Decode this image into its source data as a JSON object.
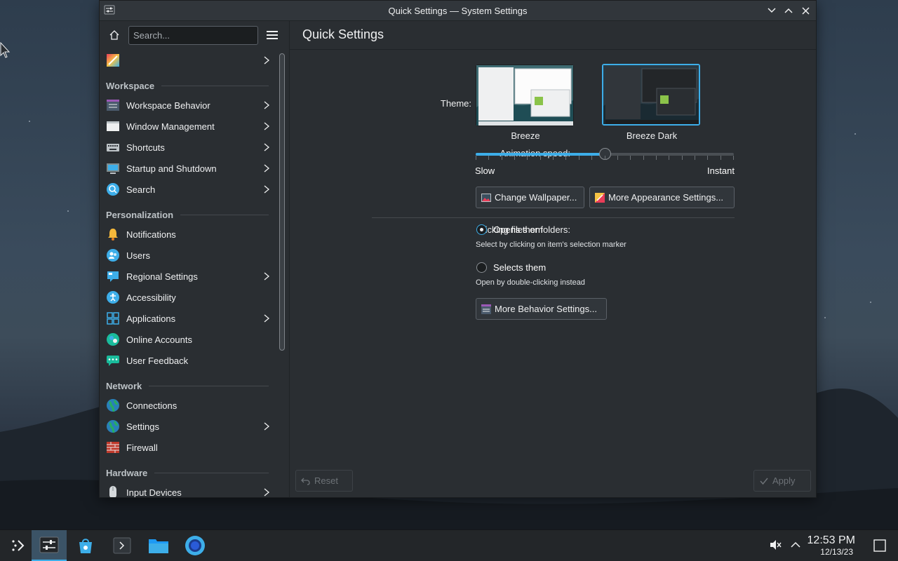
{
  "window": {
    "title": "Quick Settings — System Settings",
    "page_title": "Quick Settings"
  },
  "search": {
    "placeholder": "Search..."
  },
  "sidebar": {
    "top_item": {
      "icon": "quick-settings-icon"
    },
    "sections": [
      {
        "title": "Workspace",
        "items": [
          {
            "label": "Workspace Behavior",
            "icon": "workspace-behavior-icon",
            "has_children": true
          },
          {
            "label": "Window Management",
            "icon": "window-management-icon",
            "has_children": true
          },
          {
            "label": "Shortcuts",
            "icon": "keyboard-icon",
            "has_children": true
          },
          {
            "label": "Startup and Shutdown",
            "icon": "startup-icon",
            "has_children": true
          },
          {
            "label": "Search",
            "icon": "search-icon",
            "has_children": true
          }
        ]
      },
      {
        "title": "Personalization",
        "items": [
          {
            "label": "Notifications",
            "icon": "bell-icon",
            "has_children": false
          },
          {
            "label": "Users",
            "icon": "users-icon",
            "has_children": false
          },
          {
            "label": "Regional Settings",
            "icon": "regional-icon",
            "has_children": true
          },
          {
            "label": "Accessibility",
            "icon": "accessibility-icon",
            "has_children": false
          },
          {
            "label": "Applications",
            "icon": "applications-icon",
            "has_children": true
          },
          {
            "label": "Online Accounts",
            "icon": "online-accounts-icon",
            "has_children": false
          },
          {
            "label": "User Feedback",
            "icon": "feedback-icon",
            "has_children": false
          }
        ]
      },
      {
        "title": "Network",
        "items": [
          {
            "label": "Connections",
            "icon": "globe-icon",
            "has_children": false
          },
          {
            "label": "Settings",
            "icon": "globe-icon",
            "has_children": true
          },
          {
            "label": "Firewall",
            "icon": "firewall-icon",
            "has_children": false
          }
        ]
      },
      {
        "title": "Hardware",
        "items": [
          {
            "label": "Input Devices",
            "icon": "mouse-icon",
            "has_children": true
          }
        ]
      }
    ]
  },
  "content": {
    "theme_label": "Theme:",
    "themes": [
      {
        "name": "Breeze",
        "selected": false
      },
      {
        "name": "Breeze Dark",
        "selected": true
      }
    ],
    "animation_label": "Animation speed:",
    "animation_min": "Slow",
    "animation_max": "Instant",
    "animation_value": 0.5,
    "change_wallpaper": "Change Wallpaper...",
    "more_appearance": "More Appearance Settings...",
    "clicking_label": "Clicking files or folders:",
    "opens_them": "Opens them",
    "opens_them_hint": "Select by clicking on item's selection marker",
    "selects_them": "Selects them",
    "selects_them_hint": "Open by double-clicking instead",
    "more_behavior": "More Behavior Settings...",
    "reset": "Reset",
    "apply": "Apply"
  },
  "taskbar": {
    "time": "12:53 PM",
    "date": "12/13/23"
  },
  "colors": {
    "accent": "#3daee9",
    "window_bg": "#2a2e32",
    "panel_bg": "#232629"
  }
}
